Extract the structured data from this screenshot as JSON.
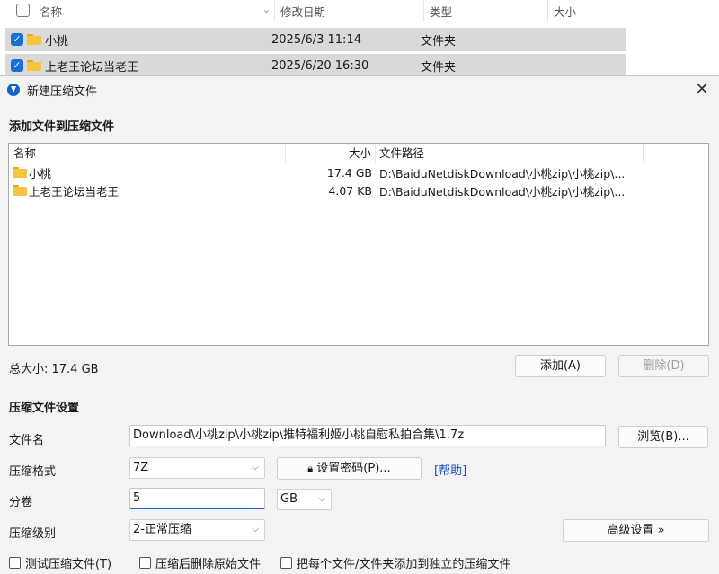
{
  "explorer": {
    "columns": {
      "name": "名称",
      "date": "修改日期",
      "type": "类型",
      "size": "大小"
    },
    "rows": [
      {
        "name": "小桃",
        "date": "2025/6/3 11:14",
        "type": "文件夹"
      },
      {
        "name": "上老王论坛当老王",
        "date": "2025/6/20 16:30",
        "type": "文件夹"
      }
    ]
  },
  "dialog": {
    "title": "新建压缩文件",
    "add_section_title": "添加文件到压缩文件",
    "file_list": {
      "headers": {
        "name": "名称",
        "size": "大小",
        "path": "文件路径"
      },
      "rows": [
        {
          "name": "小桃",
          "size": "17.4 GB",
          "path": "D:\\BaiduNetdiskDownload\\小桃zip\\小桃zip\\..."
        },
        {
          "name": "上老王论坛当老王",
          "size": "4.07 KB",
          "path": "D:\\BaiduNetdiskDownload\\小桃zip\\小桃zip\\..."
        }
      ]
    },
    "total_size": "总大小: 17.4 GB",
    "add_button": "添加(A)",
    "delete_button": "删除(D)",
    "settings_title": "压缩文件设置",
    "filename_label": "文件名",
    "filename_value": "Download\\小桃zip\\小桃zip\\推特福利姬小桃自慰私拍合集\\1.7z",
    "browse_button": "浏览(B)...",
    "format_label": "压缩格式",
    "format_value": "7Z",
    "password_button": "设置密码(P)...",
    "help_link": "[帮助]",
    "volume_label": "分卷",
    "volume_value": "5",
    "volume_unit": "GB",
    "level_label": "压缩级别",
    "level_value": "2-正常压缩",
    "advanced_button": "高级设置 »",
    "options": {
      "test": "测试压缩文件(T)",
      "delete_after": "压缩后删除原始文件",
      "separate": "把每个文件/文件夹添加到独立的压缩文件"
    },
    "icons": {
      "app": "app-logo-icon",
      "close": "close-icon",
      "folder": "folder-icon",
      "lock": "lock-icon",
      "chevron": "chevron-down-icon"
    }
  }
}
